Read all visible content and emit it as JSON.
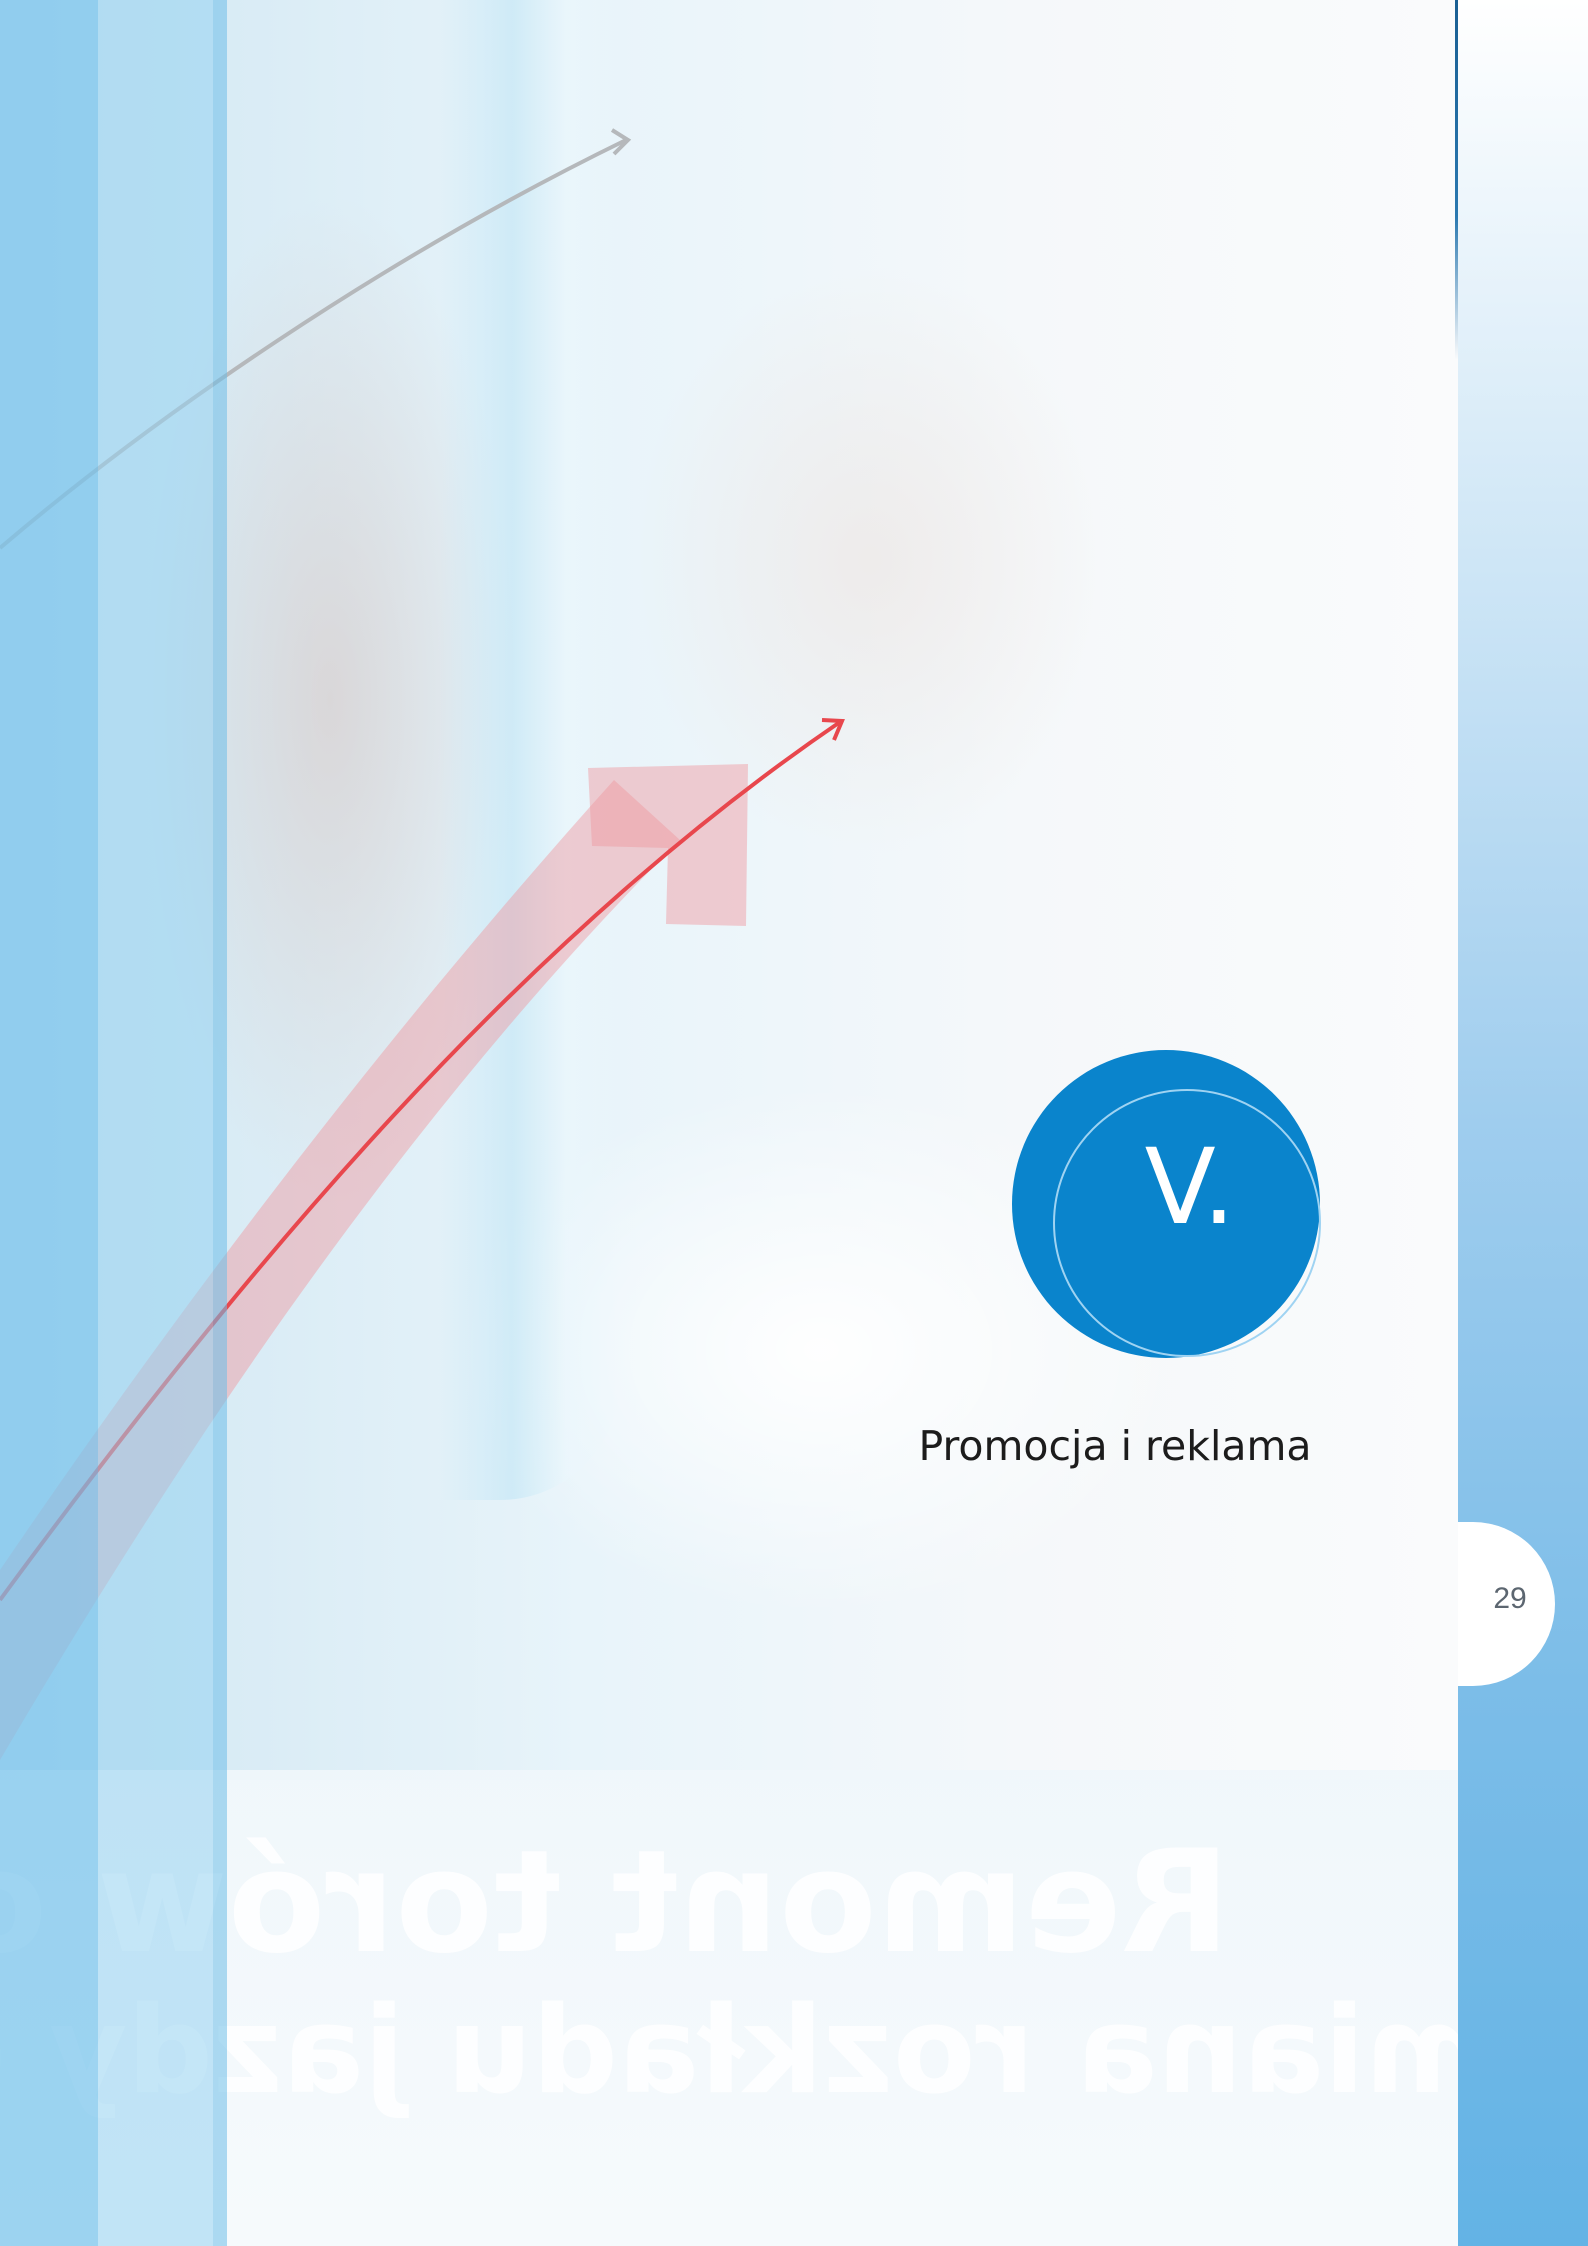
{
  "page": {
    "page_number": "29"
  },
  "chapter": {
    "numeral": "V.",
    "title": "Promocja i reklama"
  },
  "background_text": {
    "line1": "Remont torów o",
    "line2": "miana rozkładu jazdy - więc"
  },
  "colors": {
    "chapter_circle": "#0a84cc",
    "arrow_red": "#e8474d",
    "arrow_gray": "#b5b8bb",
    "margin_blue": "#63b3e5"
  }
}
